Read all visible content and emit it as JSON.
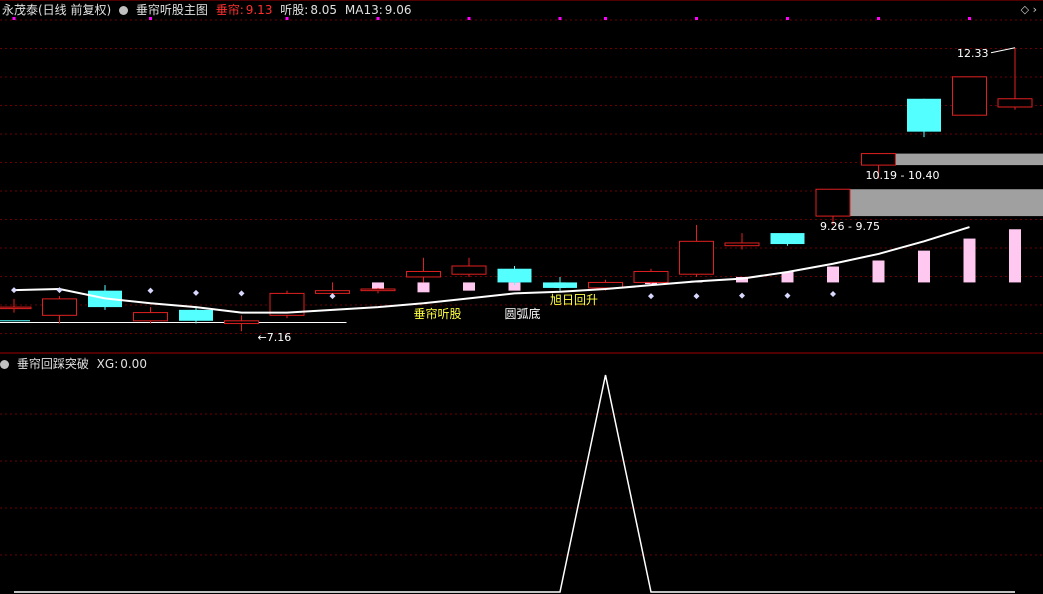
{
  "main_panel": {
    "stock_title": "永茂泰(日线 前复权)",
    "indicator_name": "垂帘听股主图",
    "field_cl_label": "垂帘:",
    "field_cl_value": "9.13",
    "field_tg_label": "听股:",
    "field_tg_value": "8.05",
    "field_ma_label": "MA13:",
    "field_ma_value": "9.06",
    "icons": [
      "diamond-icon",
      "chevron-right-icon"
    ],
    "annotations": {
      "high_price": "12.33",
      "low_price": "7.16",
      "zone_upper": "10.19 - 10.40",
      "zone_lower": "9.26 - 9.75",
      "signal_cl": "垂帘听股",
      "signal_yhd": "圆弧底",
      "signal_xr": "旭日回升"
    }
  },
  "sub_panel": {
    "indicator_name": "垂帘回踩突破",
    "xg_label": "XG:",
    "xg_value": "0.00"
  },
  "colors": {
    "up": "#e02020",
    "down": "#54ffff",
    "grid": "#6a0000",
    "ma": "#ffffff",
    "bar": "#ffc8f0",
    "zone": "#a0a0a0",
    "signal": "#ffff40",
    "dot": "#d8d8ff",
    "marker": "#ff00ff",
    "value_red": "#ff3030"
  },
  "chart_data": {
    "type": "candlestick",
    "candles": [
      {
        "o": 7.6,
        "c": 7.6,
        "h": 7.75,
        "l": 7.5
      },
      {
        "o": 7.45,
        "c": 7.75,
        "h": 7.8,
        "l": 7.3
      },
      {
        "o": 7.9,
        "c": 7.6,
        "h": 8.0,
        "l": 7.55
      },
      {
        "o": 7.35,
        "c": 7.5,
        "h": 7.6,
        "l": 7.3
      },
      {
        "o": 7.55,
        "c": 7.35,
        "h": 7.6,
        "l": 7.3
      },
      {
        "o": 7.3,
        "c": 7.35,
        "h": 7.45,
        "l": 7.16
      },
      {
        "o": 7.45,
        "c": 7.85,
        "h": 7.9,
        "l": 7.4
      },
      {
        "o": 7.85,
        "c": 7.9,
        "h": 8.05,
        "l": 7.85
      },
      {
        "o": 7.9,
        "c": 7.93,
        "h": 7.95,
        "l": 7.85
      },
      {
        "o": 8.15,
        "c": 8.25,
        "h": 8.5,
        "l": 8.05
      },
      {
        "o": 8.2,
        "c": 8.35,
        "h": 8.5,
        "l": 8.15
      },
      {
        "o": 8.3,
        "c": 8.05,
        "h": 8.35,
        "l": 8.0
      },
      {
        "o": 8.05,
        "c": 7.95,
        "h": 8.15,
        "l": 7.9
      },
      {
        "o": 7.95,
        "c": 8.05,
        "h": 8.1,
        "l": 7.9
      },
      {
        "o": 8.05,
        "c": 8.25,
        "h": 8.3,
        "l": 8.0
      },
      {
        "o": 8.2,
        "c": 8.8,
        "h": 9.1,
        "l": 8.15
      },
      {
        "o": 8.72,
        "c": 8.77,
        "h": 8.95,
        "l": 8.65
      },
      {
        "o": 8.95,
        "c": 8.75,
        "h": 8.95,
        "l": 8.72
      },
      {
        "o": 9.26,
        "c": 9.75,
        "h": 9.75,
        "l": 9.1
      },
      {
        "o": 10.19,
        "c": 10.4,
        "h": 10.4,
        "l": 9.95
      },
      {
        "o": 11.4,
        "c": 10.8,
        "h": 11.4,
        "l": 10.7
      },
      {
        "o": 11.1,
        "c": 11.8,
        "h": 11.8,
        "l": 11.1
      },
      {
        "o": 11.25,
        "c": 11.4,
        "h": 12.33,
        "l": 11.2
      }
    ],
    "ma13": [
      7.91,
      7.93,
      7.76,
      7.67,
      7.6,
      7.5,
      7.5,
      7.55,
      7.6,
      7.67,
      7.76,
      7.85,
      7.88,
      7.93,
      8.0,
      8.07,
      8.12,
      8.24,
      8.39,
      8.57,
      8.8,
      9.06
    ],
    "ma13_start_index": 1,
    "bars": [
      0,
      0,
      0,
      0,
      0,
      0,
      0,
      0,
      -0.15,
      -0.18,
      -0.15,
      -0.15,
      -0.1,
      -0.06,
      -0.03,
      0.03,
      0.1,
      0.19,
      0.29,
      0.4,
      0.58,
      0.8,
      0.97
    ],
    "bar_baseline": 8.05,
    "dots": [
      7.91,
      7.91,
      null,
      7.9,
      7.86,
      7.85,
      null,
      7.8,
      null,
      null,
      null,
      null,
      null,
      null,
      7.8,
      7.8,
      7.81,
      7.81,
      7.84,
      null,
      null,
      null,
      null
    ],
    "marker_indices": [
      0,
      3,
      6,
      8,
      10,
      12,
      13,
      15,
      17,
      19,
      21
    ],
    "support_line": {
      "from_index": 0,
      "to_index": 7,
      "value": 7.32
    },
    "support_line_left": {
      "from_index": 0,
      "to_index": 0,
      "value": 7.35
    },
    "zones": [
      {
        "label": "9.26 - 9.75",
        "low": 9.26,
        "high": 9.75,
        "from_index": 18
      },
      {
        "label": "10.19 - 10.40",
        "low": 10.19,
        "high": 10.4,
        "from_index": 19
      }
    ],
    "high_label_index": 22,
    "low_label_index": 5,
    "signals": [
      {
        "text": "垂帘听股",
        "index": 9
      },
      {
        "text": "圆弧底",
        "index": 11
      },
      {
        "text": "旭日回升",
        "index": 12
      }
    ],
    "y_range": [
      7.0,
      12.8
    ],
    "xg": [
      0,
      0,
      0,
      0,
      0,
      0,
      0,
      0,
      0,
      0,
      0,
      0,
      0,
      1,
      0,
      0,
      0,
      0,
      0,
      0,
      0,
      0,
      0
    ],
    "xg_range": [
      0,
      1
    ]
  }
}
